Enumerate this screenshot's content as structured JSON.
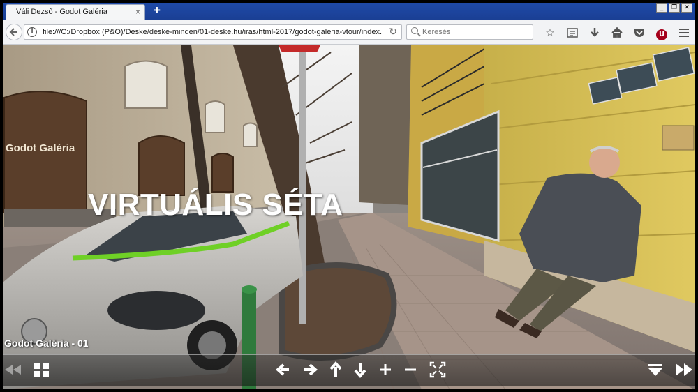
{
  "browser": {
    "tab_title": "Váli Dezső - Godot Galéria",
    "tab_close": "×",
    "new_tab": "+",
    "window_controls": [
      "_",
      "❐",
      "✕"
    ],
    "url": "file:///C:/Dropbox (P&O)/Deske/deske-minden/01-deske.hu/iras/html-2017/godot-galeria-vtour/index.h",
    "search_placeholder": "Keresés",
    "toolbar_icons": [
      "star-icon",
      "reading-list-icon",
      "download-icon",
      "home-icon",
      "pocket-icon",
      "ublock-icon",
      "menu-icon"
    ],
    "ublock_label": "U"
  },
  "tour": {
    "overlay_title": "VIRTUÁLIS SÉTA",
    "scene_name": "Godot Galéria - 01",
    "storefront_sign": "Godot Galéria"
  },
  "colors": {
    "tab_bar": "#1f4aa8",
    "accent_green": "#6fd026",
    "wall_yellow": "#d9c35a"
  }
}
